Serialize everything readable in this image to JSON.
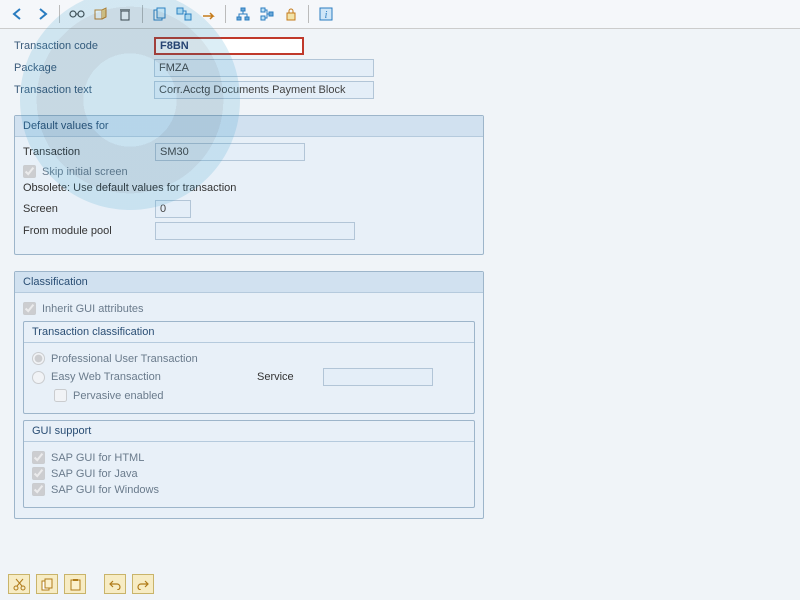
{
  "header_fields": {
    "tcode_label": "Transaction code",
    "tcode_value": "F8BN",
    "package_label": "Package",
    "package_value": "FMZA",
    "text_label": "Transaction text",
    "text_value": "Corr.Acctg Documents Payment Block"
  },
  "defaults_group": {
    "title": "Default values for",
    "transaction_label": "Transaction",
    "transaction_value": "SM30",
    "skip_initial_label": "Skip initial screen",
    "obsolete_note": "Obsolete: Use default values for transaction",
    "screen_label": "Screen",
    "screen_value": "0",
    "module_pool_label": "From module pool",
    "module_pool_value": ""
  },
  "classification_group": {
    "title": "Classification",
    "inherit_label": "Inherit GUI attributes",
    "trans_class": {
      "title": "Transaction classification",
      "professional_label": "Professional User Transaction",
      "easyweb_label": "Easy Web Transaction",
      "service_label": "Service",
      "service_value": "",
      "pervasive_label": "Pervasive enabled"
    },
    "gui_support": {
      "title": "GUI support",
      "html_label": "SAP GUI for HTML",
      "java_label": "SAP GUI for Java",
      "windows_label": "SAP GUI for Windows"
    }
  }
}
